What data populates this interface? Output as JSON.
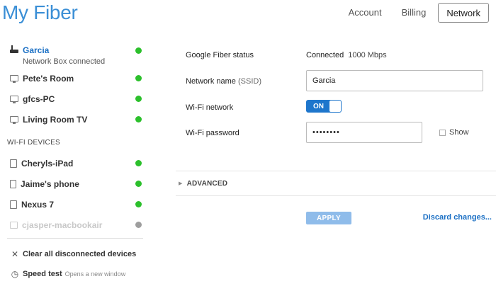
{
  "app": {
    "title": "My Fiber"
  },
  "nav": {
    "items": [
      {
        "label": "Account",
        "active": false
      },
      {
        "label": "Billing",
        "active": false
      },
      {
        "label": "Network",
        "active": true
      }
    ]
  },
  "sidebar": {
    "gateway": {
      "name": "Garcia",
      "status": "Network Box connected",
      "connected": true,
      "icon": "router-icon"
    },
    "wired_devices": [
      {
        "name": "Pete's Room",
        "connected": true,
        "icon": "monitor-icon"
      },
      {
        "name": "gfcs-PC",
        "connected": true,
        "icon": "monitor-icon"
      },
      {
        "name": "Living Room TV",
        "connected": true,
        "icon": "monitor-icon"
      }
    ],
    "wifi_heading": "WI-FI DEVICES",
    "wifi_devices": [
      {
        "name": "Cheryls-iPad",
        "connected": true,
        "icon": "tablet-icon"
      },
      {
        "name": "Jaime's phone",
        "connected": true,
        "icon": "phone-icon"
      },
      {
        "name": "Nexus 7",
        "connected": true,
        "icon": "tablet-icon"
      },
      {
        "name": "cjasper-macbookair",
        "connected": false,
        "icon": "laptop-icon"
      }
    ],
    "clear_label": "Clear all disconnected devices",
    "speed_test_label": "Speed test",
    "speed_test_note": "Opens a new window"
  },
  "settings": {
    "status_label": "Google Fiber status",
    "status_value": "Connected",
    "status_speed": "1000 Mbps",
    "ssid_label": "Network name",
    "ssid_label_suffix": "(SSID)",
    "ssid_value": "Garcia",
    "wifi_label": "Wi-Fi network",
    "wifi_toggle": "ON",
    "password_label": "Wi-Fi password",
    "password_value": "••••••••",
    "show_label": "Show",
    "advanced_label": "ADVANCED",
    "apply_label": "APPLY",
    "discard_label": "Discard changes..."
  },
  "colors": {
    "brand": "#3b8fd6",
    "link": "#1a6fc4",
    "connected_dot": "#2cc02c",
    "disconnected_dot": "#9e9e9e",
    "toggle_on": "#1e76cc",
    "apply_disabled": "#8fbcea"
  }
}
